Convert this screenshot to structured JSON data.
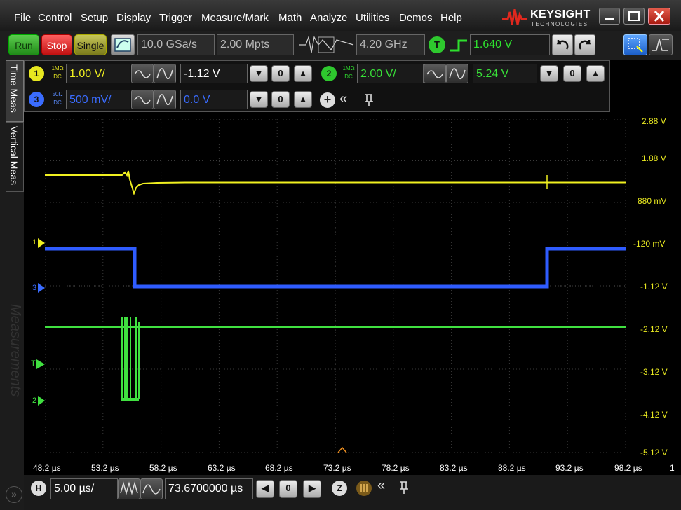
{
  "menu": [
    "File",
    "Control",
    "Setup",
    "Display",
    "Trigger",
    "Measure/Mark",
    "Math",
    "Analyze",
    "Utilities",
    "Demos",
    "Help"
  ],
  "brand": {
    "name": "KEYSIGHT",
    "sub": "TECHNOLOGIES",
    "color": "#e0281e"
  },
  "window_controls": [
    "minimize-icon",
    "maximize-icon",
    "close-icon"
  ],
  "toolbar": {
    "run_label": "Run",
    "stop_label": "Stop",
    "single_label": "Single",
    "sample_rate": "10.0 GSa/s",
    "memory_depth": "2.00 Mpts",
    "bandwidth": "4.20 GHz",
    "trigger_badge": "T",
    "trigger_level": "1.640 V"
  },
  "side_tabs": [
    "Time Meas",
    "Vertical Meas"
  ],
  "channels": [
    {
      "num": "1",
      "coupling_top": "1MΩ",
      "coupling_bot": "DC",
      "scale": "1.00 V/",
      "offset": "-1.12 V",
      "color": "#f0f020"
    },
    {
      "num": "2",
      "coupling_top": "1MΩ",
      "coupling_bot": "DC",
      "scale": "2.00 V/",
      "offset": "5.24 V",
      "color": "#38e038"
    },
    {
      "num": "3",
      "coupling_top": "50Ω",
      "coupling_bot": "DC",
      "scale": "500 mV/",
      "offset": "0.0 V",
      "color": "#3a6cff"
    }
  ],
  "watermark": "Measurements",
  "volt_labels": [
    "2.88 V",
    "1.88 V",
    "880 mV",
    "-120 mV",
    "-1.12 V",
    "-2.12 V",
    "-3.12 V",
    "-4.12 V",
    "-5.12 V"
  ],
  "time_labels": [
    "48.2 µs",
    "53.2 µs",
    "58.2 µs",
    "63.2 µs",
    "68.2 µs",
    "73.2 µs",
    "78.2 µs",
    "83.2 µs",
    "88.2 µs",
    "93.2 µs",
    "98.2 µs"
  ],
  "time_label_extra": "1",
  "markers": {
    "ch1": "1",
    "ch3": "3",
    "trig": "T",
    "ch2": "2"
  },
  "horizontal": {
    "badge": "H",
    "scale": "5.00 µs/",
    "position": "73.6700000 µs"
  }
}
